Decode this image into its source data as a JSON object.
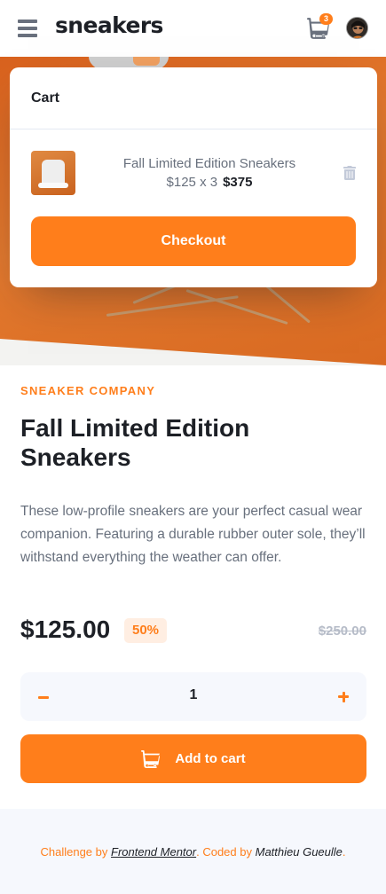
{
  "header": {
    "logo": "sneakers",
    "cart_count": "3",
    "icons": {
      "menu": "hamburger-menu-icon",
      "cart": "cart-icon",
      "avatar": "user-avatar"
    }
  },
  "cart": {
    "title": "Cart",
    "item": {
      "name": "Fall Limited Edition Sneakers",
      "unit_price": "$125 x 3",
      "total": "$375"
    },
    "checkout_label": "Checkout",
    "delete_icon": "trash-icon"
  },
  "product": {
    "company": "SNEAKER COMPANY",
    "title": "Fall Limited Edition Sneakers",
    "description": "These low-profile sneakers are your perfect casual wear companion. Featuring a durable rubber outer sole, they’ll withstand everything the weather can offer.",
    "price": "$125.00",
    "discount": "50%",
    "old_price": "$250.00",
    "quantity": "1",
    "add_to_cart_label": "Add to cart"
  },
  "footer": {
    "challenge_by": "Challenge by",
    "frontend_mentor": "Frontend Mentor",
    "coded_by": ". Coded by",
    "author": "Matthieu Gueulle",
    "end": "."
  },
  "colors": {
    "accent": "#ff7e1b",
    "pale_accent": "#ffeee2",
    "dark_text": "#1d2026",
    "grey_text": "#68707d",
    "light_bg": "#f6f8fd"
  }
}
